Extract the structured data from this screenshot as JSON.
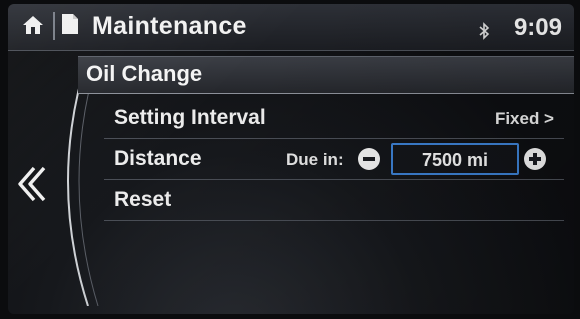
{
  "header": {
    "home_icon": "home-icon",
    "doc_icon": "document-icon",
    "title": "Maintenance",
    "bluetooth_icon": "bluetooth-icon",
    "time": "9:09"
  },
  "nav": {
    "back_icon": "chevron-left-icon"
  },
  "section": {
    "title": "Oil Change"
  },
  "rows": {
    "interval": {
      "label": "Setting Interval",
      "value": "Fixed >"
    },
    "distance": {
      "label": "Distance",
      "due_label": "Due in:",
      "value": "7500 mi"
    },
    "reset": {
      "label": "Reset"
    }
  },
  "colors": {
    "selection_border": "#3c7fd0",
    "text": "#f2f2f2",
    "background": "#16181c"
  }
}
